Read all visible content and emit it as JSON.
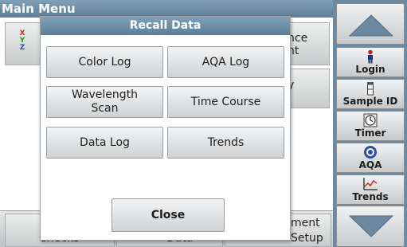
{
  "background": {
    "title": "Main Menu",
    "xyz_glyphs": [
      "X",
      "Y",
      "Z"
    ],
    "tile_fragments": {
      "top_right_line1": "nce",
      "top_right_line2": "nt",
      "mid_right": "y"
    },
    "bottom_fragments": {
      "left_line1": "S",
      "left_line2": "Checks",
      "middle": "Data",
      "right_line1": "ment",
      "right_line2": "Setup"
    }
  },
  "sidebar": {
    "scroll_up_label": "",
    "scroll_down_label": "",
    "items": [
      {
        "label": "Login",
        "icon": "person-icon"
      },
      {
        "label": "Sample ID",
        "icon": "vial-icon"
      },
      {
        "label": "Timer",
        "icon": "timer-icon"
      },
      {
        "label": "AQA",
        "icon": "aqa-icon"
      },
      {
        "label": "Trends",
        "icon": "trends-icon"
      }
    ]
  },
  "dialog": {
    "title": "Recall Data",
    "buttons": [
      {
        "label": "Color Log"
      },
      {
        "label": "AQA Log"
      },
      {
        "label": "Wavelength Scan"
      },
      {
        "label": "Time Course"
      },
      {
        "label": "Data Log"
      },
      {
        "label": "Trends"
      }
    ],
    "close_label": "Close"
  },
  "colors": {
    "title_bar": "#6f90aa",
    "sidebar": "#6d8aa0",
    "button_face": "#e2e3e4",
    "xyz": [
      "#d62a2a",
      "#2f9a2f",
      "#2a4fb0"
    ]
  }
}
